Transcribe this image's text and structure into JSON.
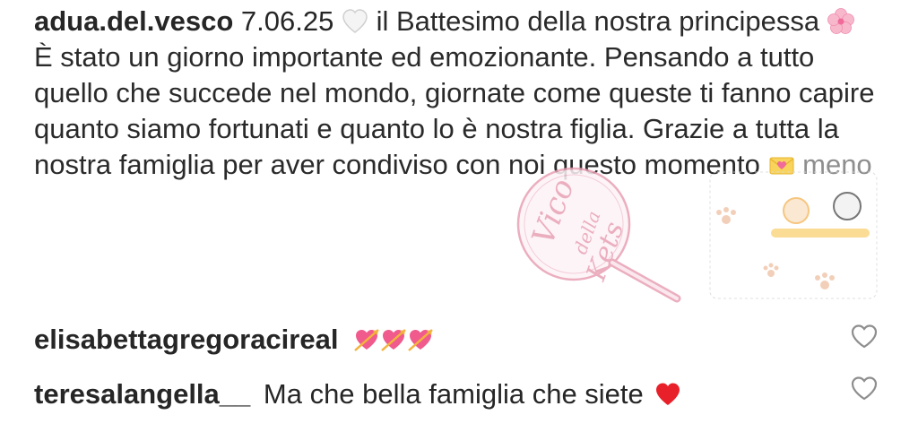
{
  "post": {
    "username": "adua.del.vesco",
    "date": "7.06.25",
    "caption_part1": "il Battesimo della nostra principessa",
    "caption_part2": "È stato un giorno importante ed emozionante. Pensando a tutto quello che succede nel mondo, giornate come queste ti fanno capire quanto siamo fortunati e quanto lo è nostra figlia. Grazie a tutta la nostra famiglia per aver condiviso con noi questo momento",
    "more_label": "meno",
    "emojis": [
      "white-heart-icon",
      "pink-flower-icon",
      "love-letter-icon"
    ]
  },
  "comments": [
    {
      "username": "elisabettagregoraci​real",
      "text": "",
      "emojis": [
        "heart-arrow-icon",
        "heart-arrow-icon",
        "heart-arrow-icon"
      ]
    },
    {
      "username": "teresalangella__",
      "text": "Ma che bella famiglia che siete",
      "emojis": [
        "red-heart-icon"
      ]
    }
  ],
  "colors": {
    "text": "#262626",
    "muted": "#8e8e8e",
    "red_heart": "#e8202a",
    "pink_heart": "#f05a8c",
    "watermark_pink": "#e8a0b4"
  }
}
